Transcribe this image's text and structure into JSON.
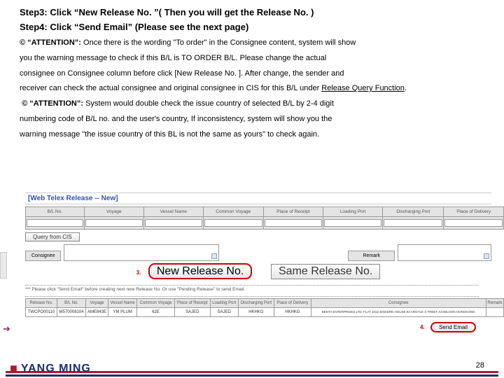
{
  "step3": "Step3: Click “New Release No. ”( Then you will get the Release No. )",
  "step4": "Step4: Click “Send Email” (Please see the next page)",
  "att1_lead": "© “ATTENTION”:",
  "att1_a": "Once there is the wording \"To order\" in the Consignee content, system will show",
  "att1_b": "you the warning message to check if this B/L is TO ORDER B/L. Please change the actual",
  "att1_c": "consignee on Consignee column before click [New Release No. ]. After change, the sender and",
  "att1_d": "receiver can check the actual consignee and original consignee in CIS for this B/L under ",
  "att1_link": "Release Query Function",
  "att2_lead": "© “ATTENTION”:",
  "att2_a": "System would double check the issue country of selected B/L by 2-4 digit",
  "att2_b": "numbering code of B/L no. and the user's country, If inconsistency, system will show you the",
  "att2_c": "warning message \"the issue country of this BL is not the same as yours\" to check again.",
  "app_title": "[Web Telex Release -- New]",
  "headers1": [
    "B/L No.",
    "Voyage",
    "Vessel Name",
    "Common Voyage",
    "Place of Receipt",
    "Loading Port",
    "Discharging Port",
    "Place of Delivery"
  ],
  "query_btn": "Query from CIS",
  "cons_label": "Consignee",
  "remark_label": "Remark",
  "step3_num": "3.",
  "new_release_btn": "New Release No.",
  "same_release_btn": "Same Release No.",
  "note": "*** Please click \"Send Email\" before creating next new Release No. Or use \"Pending Release\" to send Email.",
  "headers2": [
    "Release No.",
    "B/L No.",
    "Voyage",
    "Vessel Name",
    "Common Voyage",
    "Place of Receipt",
    "Loading Port",
    "Discharging Port",
    "Place of Delivery",
    "Consignee",
    "Remark"
  ],
  "row": [
    "TWCPO00110",
    "M570008104",
    "AME843E",
    "YM PLUM",
    "62E",
    "SAJED",
    "SAJED",
    "HKHKG",
    "HKHKG",
    "BENTA ENTERPRISES LTD. FLAT 1013 SINCERE HOUSE 83 ARGYLE S TREET, KOWLOON HONGKONG",
    ""
  ],
  "step4_num": "4.",
  "send_btn": "Send Email",
  "page_no": "28",
  "logo_text": "YANG MING"
}
